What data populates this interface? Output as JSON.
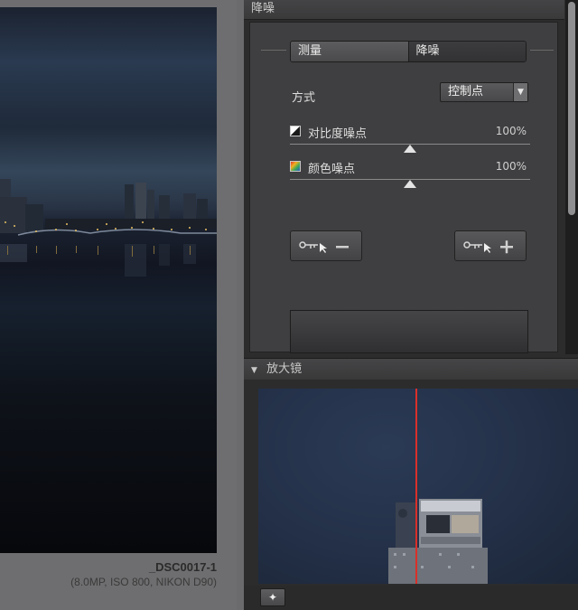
{
  "photo": {
    "filename": "_DSC0017-1",
    "meta": "(8.0MP, ISO 800, NIKON D90)"
  },
  "noise_reduction": {
    "title": "降噪",
    "tabs": [
      {
        "label": "测量",
        "active": true
      },
      {
        "label": "降噪",
        "active": false
      }
    ],
    "method_label": "方式",
    "method_value": "控制点",
    "contrast_noise_label": "对比度噪点",
    "contrast_noise_pct": "100%",
    "contrast_noise_level": 0.5,
    "color_noise_label": "颜色噪点",
    "color_noise_pct": "100%",
    "color_noise_level": 0.5,
    "remove_point_icon": "minus-icon",
    "add_point_icon": "plus-icon"
  },
  "magnifier": {
    "title": "放大镜",
    "pin_icon": "pin-icon"
  },
  "colors": {
    "panel_bg": "#3f3e40",
    "accent_line": "#d9302a"
  }
}
